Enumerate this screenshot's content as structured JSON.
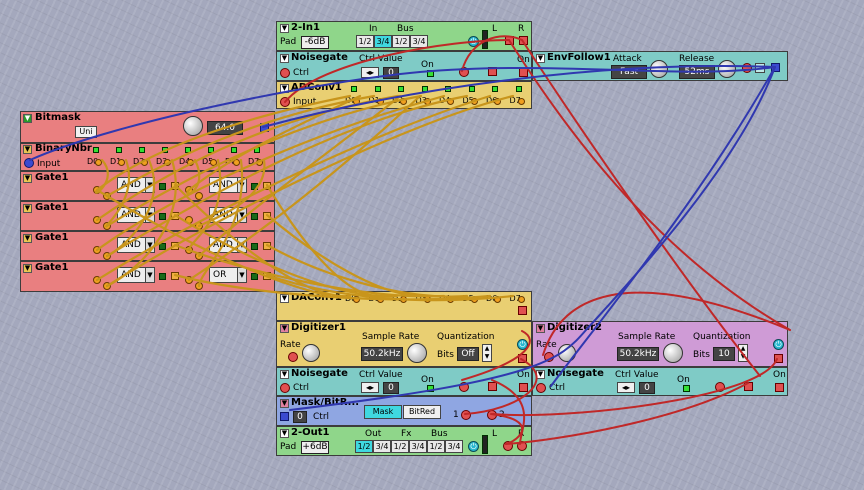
{
  "modules": {
    "in1": {
      "title": "2-In1",
      "pad_label": "Pad",
      "pad_value": "-6dB",
      "in_label": "In",
      "bus_label": "Bus",
      "in_opts": [
        "1/2",
        "3/4"
      ],
      "bus_opts": [
        "1/2",
        "3/4"
      ],
      "l": "L",
      "r": "R"
    },
    "noisegate1": {
      "title": "Noisegate",
      "ctrl": "Ctrl",
      "ctrl_value_label": "Ctrl Value",
      "value": "0",
      "on": "On",
      "on2": "On"
    },
    "envfollow": {
      "title": "EnvFollow1",
      "attack_label": "Attack",
      "attack_value": "Fast",
      "release_label": "Release",
      "release_value": "52ms"
    },
    "adconv": {
      "title": "ADConv1",
      "input": "Input",
      "bits": [
        "D0",
        "D1",
        "D2",
        "D3",
        "D4",
        "D5",
        "D6",
        "D7"
      ]
    },
    "bitmask": {
      "title": "Bitmask",
      "mode": "Uni",
      "value": "64.0"
    },
    "binary": {
      "title": "BinaryNbr",
      "input": "Input",
      "bits": [
        "D0",
        "D1",
        "D2",
        "D3",
        "D4",
        "D5",
        "D6",
        "D7"
      ]
    },
    "gates": [
      {
        "title": "Gate1",
        "op1": "AND",
        "op2": "AND"
      },
      {
        "title": "Gate1",
        "op1": "AND",
        "op2": "AND"
      },
      {
        "title": "Gate1",
        "op1": "AND",
        "op2": "AND"
      },
      {
        "title": "Gate1",
        "op1": "AND",
        "op2": "OR"
      }
    ],
    "daconv": {
      "title": "DAConv1",
      "bits": [
        "D0",
        "D1",
        "D2",
        "D3",
        "D4",
        "D5",
        "D6",
        "D7"
      ]
    },
    "digitizer1": {
      "title": "Digitizer1",
      "rate": "Rate",
      "sample_rate_label": "Sample Rate",
      "sample_rate": "50.2kHz",
      "quant_label": "Quantization",
      "bits_label": "Bits",
      "bits_value": "Off"
    },
    "digitizer2": {
      "title": "Digitizer2",
      "rate": "Rate",
      "sample_rate_label": "Sample Rate",
      "sample_rate": "50.2kHz",
      "quant_label": "Quantization",
      "bits_label": "Bits",
      "bits_value": "10"
    },
    "noisegate2": {
      "title": "Noisegate",
      "ctrl": "Ctrl",
      "ctrl_value_label": "Ctrl Value",
      "value": "0",
      "on": "On",
      "on2": "On"
    },
    "noisegate3": {
      "title": "Noisegate",
      "ctrl": "Ctrl",
      "ctrl_value_label": "Ctrl Value",
      "value": "0",
      "on": "On",
      "on2": "On"
    },
    "maskbit": {
      "title": "Mask/BitR...",
      "ctrl": "Ctrl",
      "ctrl_value": "0",
      "btn_mask": "Mask",
      "btn_bitred": "BitRed",
      "p1": "1",
      "p2": "2"
    },
    "out1": {
      "title": "2-Out1",
      "pad_label": "Pad",
      "pad_value": "+6dB",
      "out_label": "Out",
      "fx_label": "Fx",
      "bus_label": "Bus",
      "out_opts": [
        "1/2",
        "3/4"
      ],
      "fx_opts": [
        "1/2",
        "3/4"
      ],
      "bus_opts": [
        "1/2",
        "3/4"
      ],
      "l": "L",
      "r": "R"
    }
  },
  "colors": {
    "green": "#8fd68a",
    "teal": "#7fcbc6",
    "yellow": "#e9cf72",
    "red": "#e97f80",
    "purple": "#cf9bd6",
    "blue": "#8fa6e2",
    "wire_gold": "#c8951c",
    "wire_red": "#c02828",
    "wire_blue": "#3038b0"
  }
}
